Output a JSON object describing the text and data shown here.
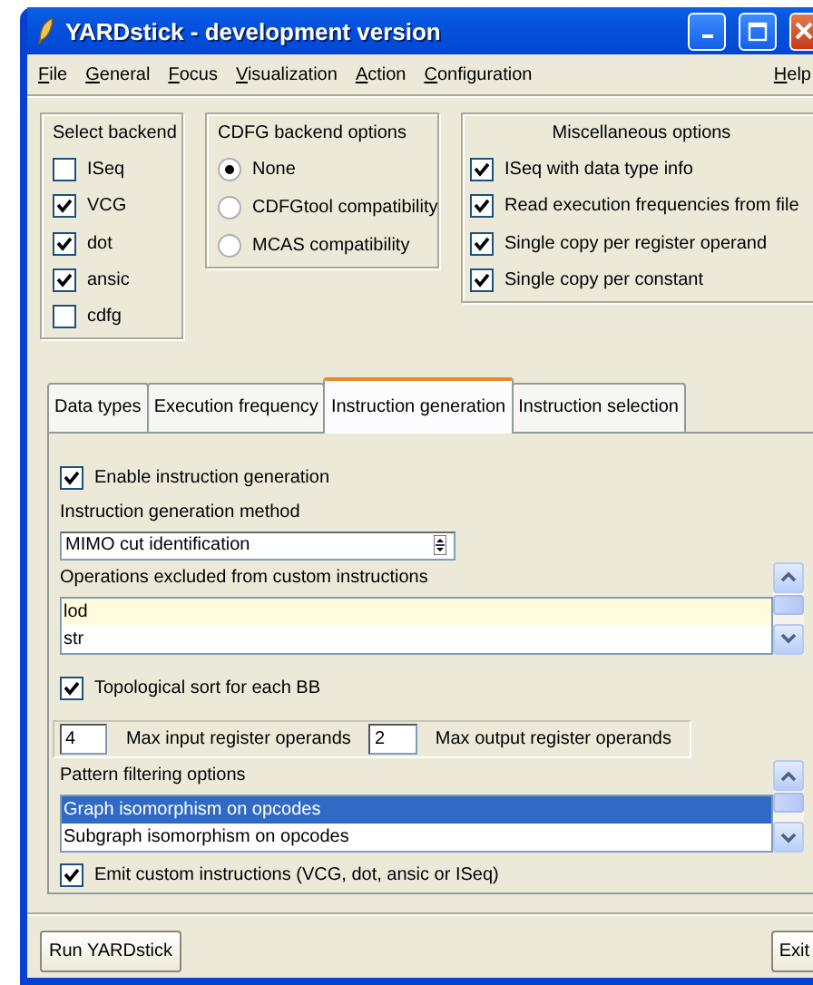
{
  "window": {
    "title": "YARDstick - development version"
  },
  "menu": [
    {
      "label": "File"
    },
    {
      "label": "General"
    },
    {
      "label": "Focus"
    },
    {
      "label": "Visualization"
    },
    {
      "label": "Action"
    },
    {
      "label": "Configuration"
    },
    {
      "label": "Help"
    }
  ],
  "backend": {
    "title": "Select backend",
    "options": [
      {
        "label": "ISeq",
        "checked": false
      },
      {
        "label": "VCG",
        "checked": true
      },
      {
        "label": "dot",
        "checked": true
      },
      {
        "label": "ansic",
        "checked": true
      },
      {
        "label": "cdfg",
        "checked": false
      }
    ]
  },
  "cdfg_options": {
    "title": "CDFG backend options",
    "options": [
      {
        "label": "None",
        "selected": true
      },
      {
        "label": "CDFGtool compatibility",
        "selected": false
      },
      {
        "label": "MCAS compatibility",
        "selected": false
      }
    ]
  },
  "misc_options": {
    "title": "Miscellaneous options",
    "options": [
      {
        "label": "ISeq with data type info",
        "checked": true
      },
      {
        "label": "Read execution frequencies from file",
        "checked": true
      },
      {
        "label": "Single copy per register operand",
        "checked": true
      },
      {
        "label": "Single copy per constant",
        "checked": true
      }
    ]
  },
  "tabs": [
    {
      "label": "Data types",
      "selected": false
    },
    {
      "label": "Execution frequency",
      "selected": false
    },
    {
      "label": "Instruction generation",
      "selected": true
    },
    {
      "label": "Instruction selection",
      "selected": false
    }
  ],
  "panel": {
    "enable": {
      "label": "Enable instruction generation",
      "checked": true
    },
    "method_label": "Instruction generation method",
    "method": {
      "value": "MIMO cut identification"
    },
    "excluded_label": "Operations excluded from custom instructions",
    "excluded": [
      {
        "label": "lod",
        "selected": true
      },
      {
        "label": "str",
        "selected": false
      }
    ],
    "topo": {
      "label": "Topological sort for each BB",
      "checked": true
    },
    "max_input": {
      "value": "4",
      "label": "Max input register operands"
    },
    "max_output": {
      "value": "2",
      "label": "Max output register operands"
    },
    "pattern_label": "Pattern filtering options",
    "patterns": [
      {
        "label": "Graph isomorphism on opcodes",
        "selected": true
      },
      {
        "label": "Subgraph isomorphism on opcodes",
        "selected": false
      }
    ],
    "emit": {
      "label": "Emit custom instructions (VCG, dot, ansic or ISeq)",
      "checked": true
    }
  },
  "buttons": [
    {
      "label": "Run YARDstick"
    },
    {
      "label": "Exit"
    }
  ]
}
